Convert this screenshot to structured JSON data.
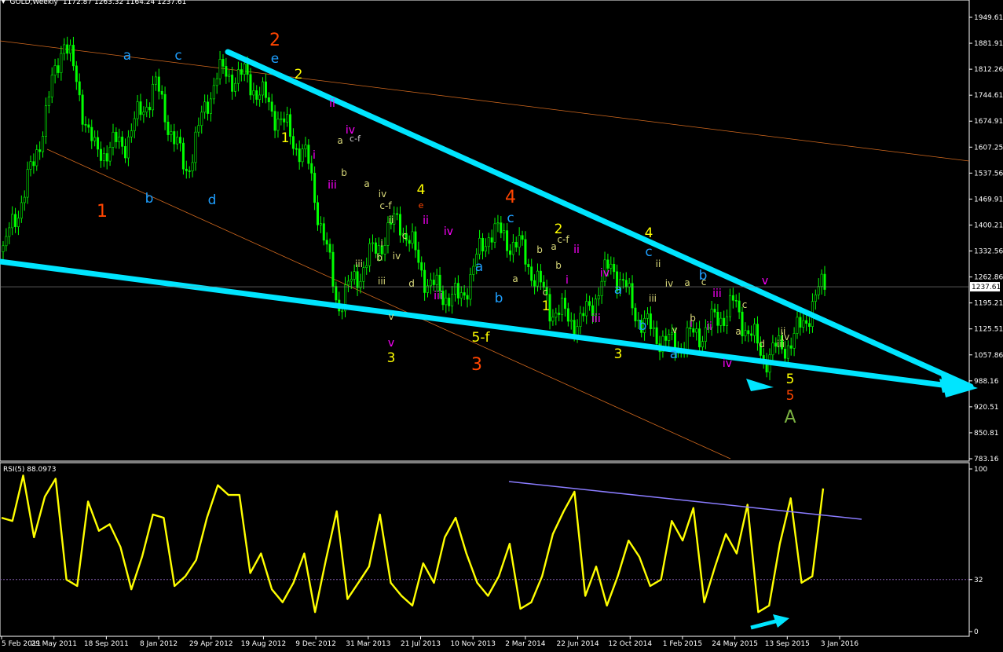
{
  "header": {
    "symbol": "GOLD,Weekly",
    "ohlc": "1172.87 1263.32 1164.24 1237.61"
  },
  "colors": {
    "background": "#000000",
    "candles": "#00ff00",
    "axis": "#ffffff",
    "trend_cyan": "#00e5ff",
    "channel_orange": "#d2691e",
    "rsi_line": "#ffff00",
    "rsi_trend": "#8a7cff",
    "rsi_level": "#7f5aa8"
  },
  "chart_data": [
    {
      "type": "line",
      "title": "",
      "subtitle": "",
      "xlabel": "",
      "ylabel": "",
      "ylim": [
        783.16,
        2015.16
      ],
      "grid": false,
      "legend": "none",
      "y_ticks": [
        "1949.61",
        "1881.91",
        "1812.26",
        "1744.61",
        "1674.91",
        "1607.25",
        "1537.56",
        "1469.91",
        "1400.21",
        "1332.56",
        "1262.86",
        "1195.21",
        "1125.51",
        "1057.86",
        "988.16",
        "920.51",
        "850.81",
        "783.16"
      ],
      "current_price_label": "1237.61",
      "x_ticks": [
        "5 Feb 2011",
        "29 May 2011",
        "18 Sep 2011",
        "8 Jan 2012",
        "29 Apr 2012",
        "19 Aug 2012",
        "9 Dec 2012",
        "31 Mar 2013",
        "21 Jul 2013",
        "10 Nov 2013",
        "2 Mar 2014",
        "22 Jun 2014",
        "12 Oct 2014",
        "1 Feb 2015",
        "24 May 2015",
        "13 Sep 2015",
        "3 Jan 2016"
      ],
      "series": [
        {
          "x": [
            "5 Feb 2011",
            "29 May 2011",
            "4 Sep 2011",
            "18 Sep 2011",
            "8 Jan 2012",
            "29 Feb 2012",
            "29 Apr 2012",
            "19 Aug 2012",
            "5 Oct 2012",
            "9 Dec 2012",
            "31 Mar 2013",
            "28 Jun 2013",
            "21 Jul 2013",
            "28 Aug 2013",
            "10 Nov 2013",
            "31 Dec 2013",
            "2 Mar 2014",
            "22 Jun 2014",
            "12 Oct 2014",
            "7 Nov 2014",
            "1 Feb 2015",
            "24 May 2015",
            "20 Jul 2015",
            "13 Sep 2015",
            "18 Oct 2015",
            "3 Dec 2015",
            "3 Jan 2016",
            "14 Feb 2016"
          ],
          "values": [
            1330,
            1560,
            1900,
            1590,
            1620,
            1770,
            1540,
            1800,
            1790,
            1690,
            1570,
            1190,
            1310,
            1420,
            1240,
            1200,
            1390,
            1340,
            1180,
            1140,
            1300,
            1140,
            1080,
            1120,
            1190,
            1050,
            1100,
            1250
          ]
        }
      ],
      "annotations": [
        {
          "text": "1",
          "color": "#ff4500"
        },
        {
          "text": "a",
          "color": "#1e9fff"
        },
        {
          "text": "b",
          "color": "#1e9fff"
        },
        {
          "text": "c",
          "color": "#1e9fff"
        },
        {
          "text": "d",
          "color": "#1e9fff"
        },
        {
          "text": "2",
          "color": "#ff4500"
        },
        {
          "text": "e",
          "color": "#1e9fff"
        },
        {
          "text": "2",
          "color": "#ffff00"
        },
        {
          "text": "1",
          "color": "#ffff00"
        },
        {
          "text": "i",
          "color": "#ff00ff"
        },
        {
          "text": "ii",
          "color": "#ff00ff"
        },
        {
          "text": "iii",
          "color": "#ff00ff"
        },
        {
          "text": "iv",
          "color": "#ff00ff"
        },
        {
          "text": "c-f",
          "color": "#cccccc"
        },
        {
          "text": "v",
          "color": "#ff00ff"
        },
        {
          "text": "3",
          "color": "#ffff00"
        },
        {
          "text": "4",
          "color": "#ffff00"
        },
        {
          "text": "e",
          "color": "#ff4500"
        },
        {
          "text": "ii",
          "color": "#ff00ff"
        },
        {
          "text": "iv",
          "color": "#ff00ff"
        },
        {
          "text": "iii",
          "color": "#ff00ff"
        },
        {
          "text": "5-f",
          "color": "#ffff00"
        },
        {
          "text": "3",
          "color": "#ff4500"
        },
        {
          "text": "4",
          "color": "#ff4500"
        },
        {
          "text": "c",
          "color": "#1e9fff"
        },
        {
          "text": "a",
          "color": "#1e9fff"
        },
        {
          "text": "b",
          "color": "#1e9fff"
        },
        {
          "text": "2",
          "color": "#ffff00"
        },
        {
          "text": "1",
          "color": "#ffff00"
        },
        {
          "text": "ii",
          "color": "#ff00ff"
        },
        {
          "text": "i",
          "color": "#ff00ff"
        },
        {
          "text": "iv",
          "color": "#ff00ff"
        },
        {
          "text": "iii",
          "color": "#ff00ff"
        },
        {
          "text": "3",
          "color": "#ffff00"
        },
        {
          "text": "4",
          "color": "#ffff00"
        },
        {
          "text": "c",
          "color": "#1e9fff"
        },
        {
          "text": "a",
          "color": "#1e9fff"
        },
        {
          "text": "b",
          "color": "#1e9fff"
        },
        {
          "text": "a",
          "color": "#1e9fff"
        },
        {
          "text": "b",
          "color": "#1e9fff"
        },
        {
          "text": "i",
          "color": "#ff00ff"
        },
        {
          "text": "ii",
          "color": "#ff00ff"
        },
        {
          "text": "iii",
          "color": "#ff00ff"
        },
        {
          "text": "iv",
          "color": "#ff00ff"
        },
        {
          "text": "v",
          "color": "#ff00ff"
        },
        {
          "text": "5",
          "color": "#ffff00"
        },
        {
          "text": "5",
          "color": "#ff4500"
        },
        {
          "text": "A",
          "color": "#7cb342"
        }
      ]
    },
    {
      "type": "line",
      "title": "RSI(5) 88.0973",
      "xlabel": "",
      "ylabel": "",
      "ylim": [
        0,
        100
      ],
      "levels": [
        32
      ],
      "y_ticks": [
        "100",
        "32",
        "0"
      ],
      "series": [
        {
          "values": [
            70,
            68,
            96,
            58,
            83,
            94,
            32,
            28,
            80,
            62,
            66,
            52,
            26,
            46,
            72,
            70,
            28,
            34,
            44,
            70,
            90,
            84,
            84,
            36,
            48,
            26,
            18,
            30,
            48,
            12,
            44,
            74,
            20,
            30,
            40,
            72,
            30,
            22,
            16,
            42,
            30,
            58,
            70,
            48,
            30,
            22,
            34,
            54,
            14,
            18,
            34,
            60,
            74,
            86,
            22,
            40,
            16,
            34,
            56,
            46,
            28,
            32,
            68,
            56,
            76,
            18,
            40,
            60,
            48,
            78,
            12,
            16,
            54,
            82,
            30,
            34,
            88
          ]
        }
      ]
    }
  ],
  "arrows": [
    {
      "name": "down-right-arrow",
      "color": "#00e5ff"
    },
    {
      "name": "up-right-arrow",
      "color": "#00e5ff"
    }
  ]
}
